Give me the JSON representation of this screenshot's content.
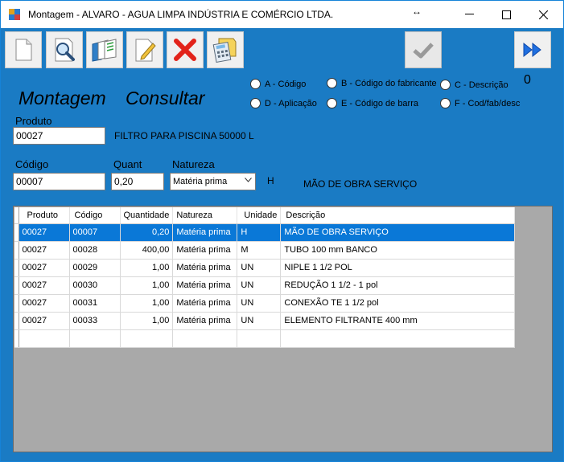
{
  "window": {
    "title": "Montagem - ALVARO - AGUA LIMPA INDÚSTRIA E COMÉRCIO LTDA.",
    "resize_glyph": "↔",
    "minimize_glyph": "—",
    "maximize_glyph": "☐",
    "close_glyph": "✕"
  },
  "toolbar": {
    "items": [
      {
        "name": "new-button",
        "icon": "new-document-icon"
      },
      {
        "name": "search-button",
        "icon": "magnifier-document-icon"
      },
      {
        "name": "copy-button",
        "icon": "stacked-documents-icon"
      },
      {
        "name": "edit-button",
        "icon": "pencil-document-icon"
      },
      {
        "name": "delete-button",
        "icon": "red-x-icon"
      },
      {
        "name": "calculator-button",
        "icon": "calculator-icon"
      }
    ],
    "confirm_icon": "checkmark-icon",
    "next_icon": "fast-forward-icon",
    "counter": "0"
  },
  "mode": {
    "module": "Montagem",
    "action": "Consultar"
  },
  "search_options": [
    {
      "label": "A - Código"
    },
    {
      "label": "B - Código do fabricante"
    },
    {
      "label": "C - Descrição"
    },
    {
      "label": "D - Aplicação"
    },
    {
      "label": "E - Código de barra"
    },
    {
      "label": "F - Cod/fab/desc"
    }
  ],
  "form": {
    "produto_label": "Produto",
    "produto_value": "00027",
    "produto_desc": "FILTRO PARA PISCINA 50000 L",
    "codigo_label": "Código",
    "codigo_value": "00007",
    "quant_label": "Quant",
    "quant_value": "0,20",
    "natureza_label": "Natureza",
    "natureza_value": "Matéria prima",
    "unidade_value": "H",
    "item_desc": "MÃO DE OBRA SERVIÇO"
  },
  "grid": {
    "columns": [
      "Produto",
      "Código",
      "Quantidade",
      "Natureza",
      "Unidade",
      "Descrição"
    ],
    "rows": [
      [
        "00027",
        "00007",
        "0,20",
        "Matéria prima",
        "H",
        "MÃO DE OBRA SERVIÇO"
      ],
      [
        "00027",
        "00028",
        "400,00",
        "Matéria prima",
        "M",
        "TUBO 100 mm BANCO"
      ],
      [
        "00027",
        "00029",
        "1,00",
        "Matéria prima",
        "UN",
        "NIPLE 1 1/2 POL"
      ],
      [
        "00027",
        "00030",
        "1,00",
        "Matéria prima",
        "UN",
        "REDUÇÃO 1 1/2 - 1 pol"
      ],
      [
        "00027",
        "00031",
        "1,00",
        "Matéria prima",
        "UN",
        "CONEXÃO TE 1 1/2 pol"
      ],
      [
        "00027",
        "00033",
        "1,00",
        "Matéria prima",
        "UN",
        "ELEMENTO FILTRANTE 400 mm"
      ]
    ]
  },
  "colors": {
    "form_background": "#1a7bc4",
    "selection": "#0a78d7"
  }
}
